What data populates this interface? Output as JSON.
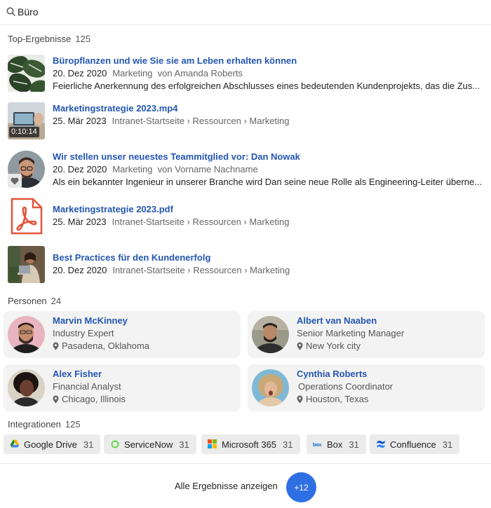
{
  "search": {
    "value": "Büro"
  },
  "top_results": {
    "heading": "Top-Ergebnisse",
    "count": "125",
    "items": [
      {
        "title": "Büropflanzen und wie Sie sie am Leben erhalten können",
        "date": "20. Dez 2020",
        "meta": "Marketing  von Amanda Roberts",
        "description": "Feierliche Anerkennung des erfolgreichen Abschlusses eines bedeutenden Kundenprojekts, das die Zus...",
        "thumb": "plant-leaves-image"
      },
      {
        "title": "Marketingstrategie 2023.mp4",
        "date": "25. Mär 2023",
        "meta": "Intranet-Startseite › Ressourcen › Marketing",
        "duration": "0:10:14",
        "thumb": "laptop-video-thumbnail"
      },
      {
        "title": "Wir stellen unser neuestes Teammitglied vor: Dan Nowak",
        "date": "20. Dez 2020",
        "meta": "Marketing  von Vorname Nachname",
        "description": "Als ein bekannter Ingenieur in unserer Branche wird Dan seine neue Rolle als Engineering-Leiter überne...",
        "thumb": "man-portrait-image",
        "badge_icon": "heart-icon"
      },
      {
        "title": "Marketingstrategie 2023.pdf",
        "date": "25. Mär 2023",
        "meta": "Intranet-Startseite › Ressourcen › Marketing",
        "thumb": "pdf-file-icon"
      },
      {
        "title": "Best Practices für den Kundenerfolg",
        "date": "20. Dez 2020",
        "meta": "Intranet-Startseite › Ressourcen › Marketing",
        "thumb": "woman-laptop-image"
      }
    ]
  },
  "people": {
    "heading": "Personen",
    "count": "24",
    "items": [
      {
        "name": "Marvin McKinney",
        "role": "Industry Expert",
        "location": "Pasadena, Oklahoma",
        "avatar_bg": "#e8b4c0"
      },
      {
        "name": "Albert van Naaben",
        "role": "Senior Marketing Manager",
        "location": "New York city",
        "avatar_bg": "#9a9a8a"
      },
      {
        "name": "Alex Fisher",
        "role": "Financial Analyst",
        "location": "Chicago, Illinois",
        "avatar_bg": "#d9d3c6"
      },
      {
        "name": "Cynthia Roberts",
        "role": "Operations Coordinator",
        "location": "Houston, Texas",
        "avatar_bg": "#7fb9d6"
      }
    ]
  },
  "integrations": {
    "heading": "Integrationen",
    "count": "125",
    "items": [
      {
        "label": "Google Drive",
        "count": "31",
        "icon": "google-drive-icon"
      },
      {
        "label": "ServiceNow",
        "count": "31",
        "icon": "servicenow-icon"
      },
      {
        "label": "Microsoft 365",
        "count": "31",
        "icon": "microsoft-365-icon"
      },
      {
        "label": "Box",
        "count": "31",
        "icon": "box-icon"
      },
      {
        "label": "Confluence",
        "count": "31",
        "icon": "confluence-icon"
      }
    ]
  },
  "footer": {
    "all_results_label": "Alle Ergebnisse anzeigen",
    "more_count": "+12"
  },
  "colors": {
    "link": "#2456b0",
    "accent": "#2f6fe4",
    "card_bg": "#f3f3f3",
    "chip_bg": "#ebebeb",
    "pdf_red": "#e2553a"
  }
}
